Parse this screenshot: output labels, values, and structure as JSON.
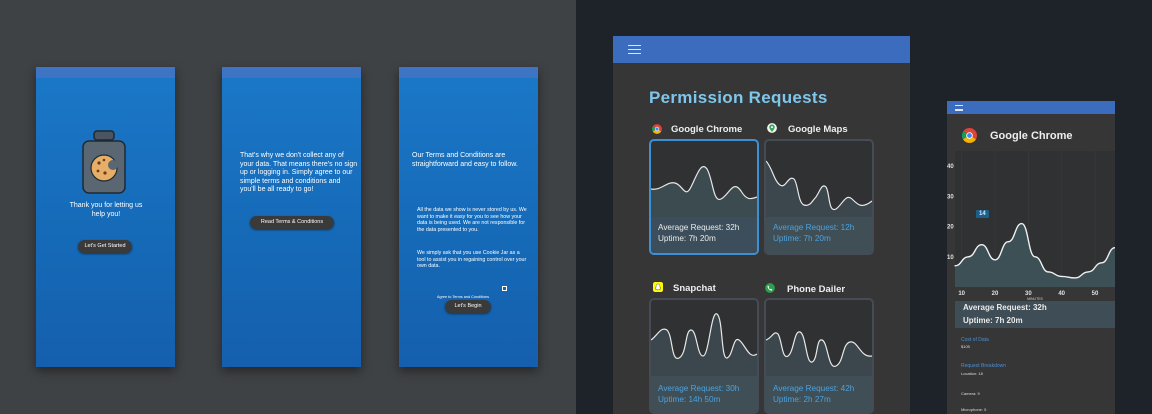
{
  "onboarding": {
    "screen1": {
      "message": "Thank you for letting us help you!",
      "button": "Let's Get Started"
    },
    "screen2": {
      "message": "That's why we don't collect any of your data. That means there's no sign up or logging in. Simply agree to our simple terms and conditions and you'll be all ready to go!",
      "button": "Read Terms & Conditions"
    },
    "screen3": {
      "intro": "Our Terms and Conditions are straightforward and easy to follow.",
      "para1": "All the data we show is never stored by us. We want to make it easy for you to see how your data is being used. We are not responsible for the data presented to you.",
      "para2": "We simply ask that you use Cookie Jar as a tool to assist you in regaining control over your own data.",
      "checkbox_label": "Agree to Terms and Conditions",
      "button": "Let's Begin"
    }
  },
  "tablet": {
    "title": "Permission Requests",
    "apps": [
      {
        "name": "Google Chrome",
        "avg": "Average Request: 32h",
        "uptime": "Uptime: 7h 20m",
        "selected": true
      },
      {
        "name": "Google Maps",
        "avg": "Average Request: 12h",
        "uptime": "Uptime: 7h 20m",
        "selected": false
      },
      {
        "name": "Snapchat",
        "avg": "Average Request: 30h",
        "uptime": "Uptime: 14h 50m",
        "selected": false
      },
      {
        "name": "Phone Dailer",
        "avg": "Average Request: 42h",
        "uptime": "Uptime: 2h 27m",
        "selected": false
      }
    ]
  },
  "detail": {
    "title": "Google Chrome",
    "badge": "14",
    "avg": "Average Request: 32h",
    "uptime": "Uptime: 7h 20m",
    "xlabel": "MINUTES",
    "sections": [
      {
        "heading": "Cost of Data",
        "value": "$105"
      },
      {
        "heading": "Request Breakdown",
        "value": "Location: 18"
      },
      {
        "heading": "",
        "value": "Camera: 9"
      },
      {
        "heading": "",
        "value": "Microphone: 5"
      }
    ]
  },
  "chart_data": {
    "type": "area",
    "x": [
      8,
      12,
      16,
      20,
      24,
      28,
      32,
      36,
      40,
      44,
      48,
      52,
      56
    ],
    "values": [
      7,
      10,
      14,
      9,
      15,
      21,
      10,
      5,
      3.5,
      3,
      5,
      8,
      13
    ],
    "xticks": [
      "10",
      "20",
      "30",
      "40",
      "50"
    ],
    "yticks": [
      "40",
      "30",
      "20",
      "10"
    ],
    "xlabel": "MINUTES",
    "ylim": [
      0,
      45
    ],
    "xlim": [
      8,
      56
    ]
  },
  "colors": {
    "primary_blue": "#1b78c8",
    "appbar": "#3b6cbd",
    "accent_text": "#7fc6ec",
    "stat_blue": "#4aa2e0",
    "card_dark": "#2f3133"
  }
}
